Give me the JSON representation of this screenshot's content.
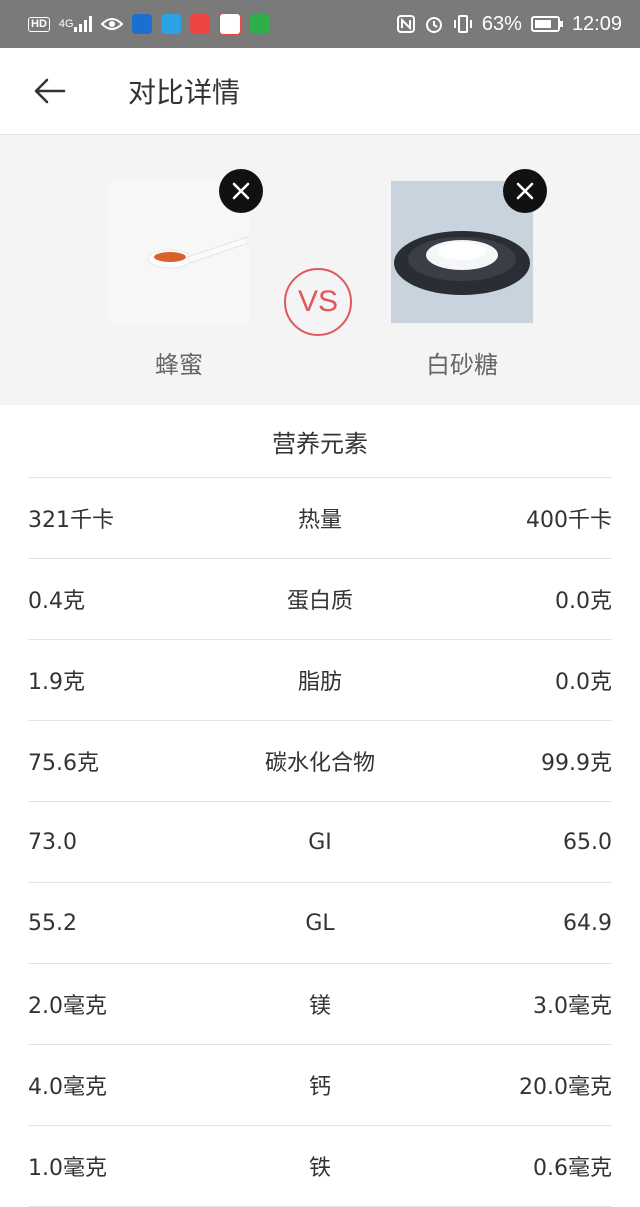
{
  "status_bar": {
    "hd": "HD",
    "network": "4G",
    "battery": "63%",
    "time": "12:09"
  },
  "header": {
    "title": "对比详情"
  },
  "compare": {
    "left_food": "蜂蜜",
    "right_food": "白砂糖",
    "vs": "VS"
  },
  "nutrition": {
    "title": "营养元素",
    "rows": [
      {
        "left": "321千卡",
        "name": "热量",
        "right": "400千卡"
      },
      {
        "left": "0.4克",
        "name": "蛋白质",
        "right": "0.0克"
      },
      {
        "left": "1.9克",
        "name": "脂肪",
        "right": "0.0克"
      },
      {
        "left": "75.6克",
        "name": "碳水化合物",
        "right": "99.9克"
      },
      {
        "left": "73.0",
        "name": "GI",
        "right": "65.0"
      },
      {
        "left": "55.2",
        "name": "GL",
        "right": "64.9"
      },
      {
        "left": "2.0毫克",
        "name": "镁",
        "right": "3.0毫克"
      },
      {
        "left": "4.0毫克",
        "name": "钙",
        "right": "20.0毫克"
      },
      {
        "left": "1.0毫克",
        "name": "铁",
        "right": "0.6毫克"
      }
    ]
  }
}
